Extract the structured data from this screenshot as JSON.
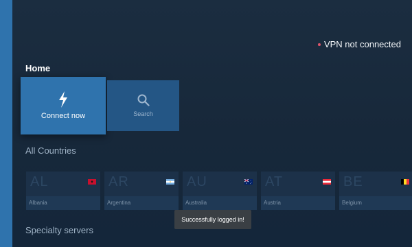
{
  "status": {
    "text": "VPN not connected",
    "dot_color": "#e0556b"
  },
  "home": {
    "title": "Home",
    "connect_label": "Connect now",
    "connect_icon": "bolt-icon",
    "search_label": "Search",
    "search_icon": "search-icon"
  },
  "countries": {
    "title": "All Countries",
    "items": [
      {
        "code": "AL",
        "name": "Albania"
      },
      {
        "code": "AR",
        "name": "Argentina"
      },
      {
        "code": "AU",
        "name": "Australia"
      },
      {
        "code": "AT",
        "name": "Austria"
      },
      {
        "code": "BE",
        "name": "Belgium"
      }
    ]
  },
  "specialty": {
    "title": "Specialty servers"
  },
  "toast": {
    "text": "Successfully logged in!"
  },
  "colors": {
    "accent": "#2f73ad",
    "background": "#1b2d40"
  }
}
